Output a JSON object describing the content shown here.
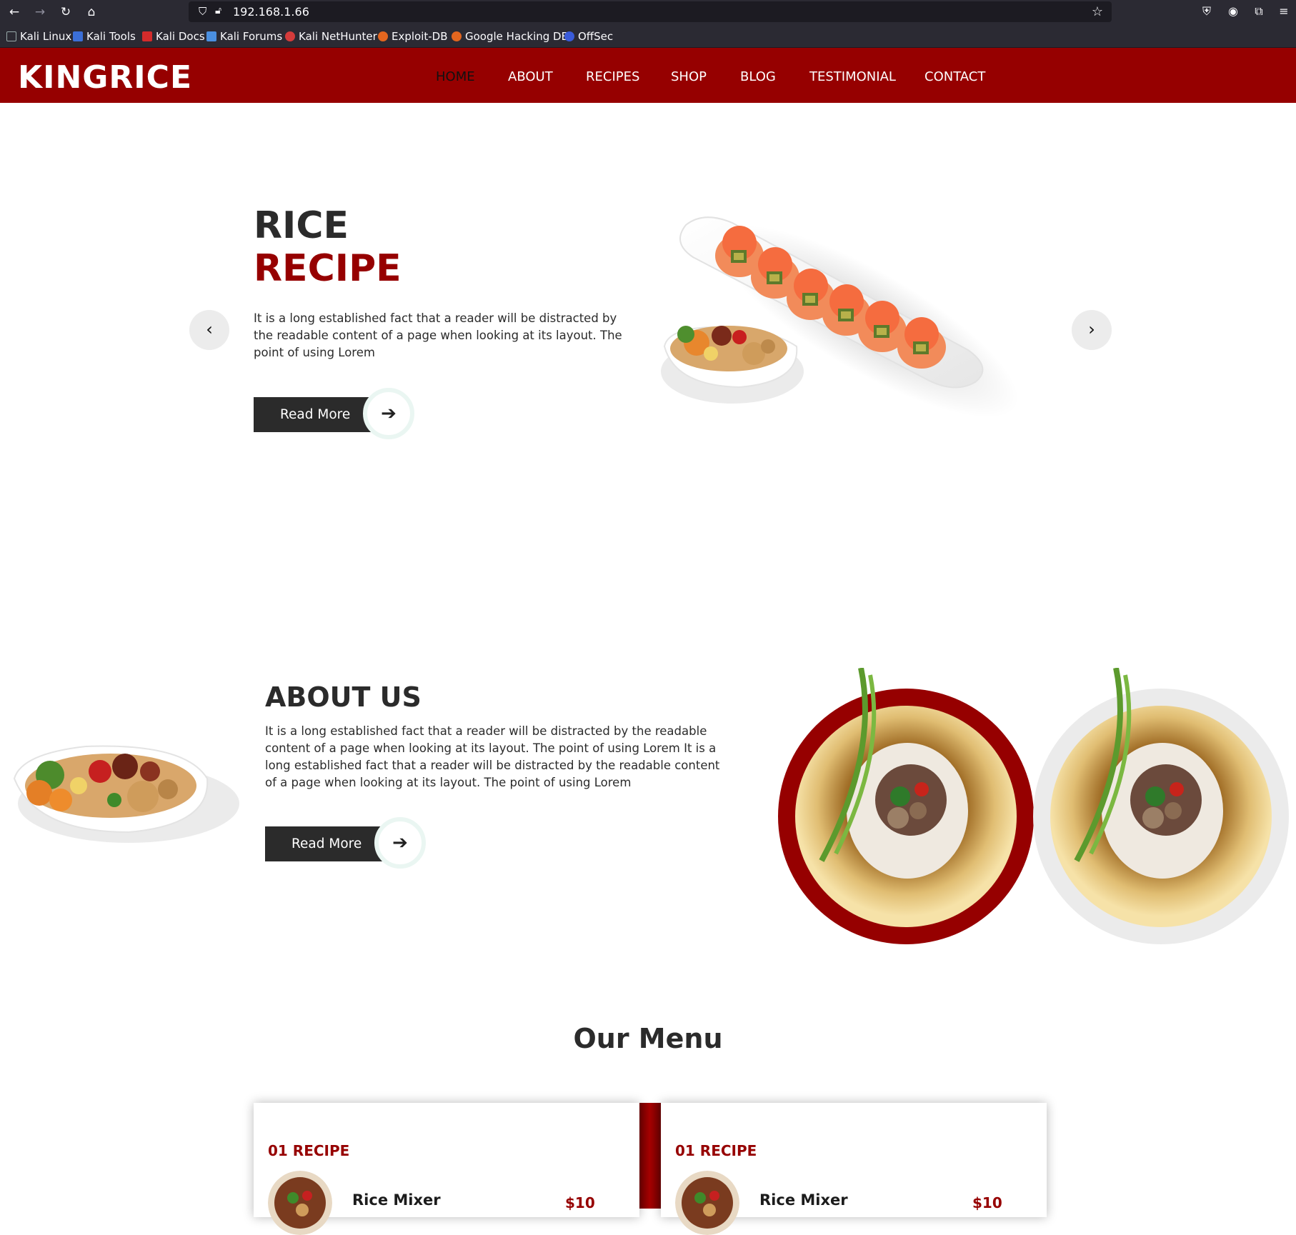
{
  "browser": {
    "url": "192.168.1.66",
    "bookmarks": [
      "Kali Linux",
      "Kali Tools",
      "Kali Docs",
      "Kali Forums",
      "Kali NetHunter",
      "Exploit-DB",
      "Google Hacking DB",
      "OffSec"
    ]
  },
  "site": {
    "logo": "KINGRICE",
    "nav": [
      "HOME",
      "ABOUT",
      "RECIPES",
      "SHOP",
      "BLOG",
      "TESTIMONIAL",
      "CONTACT"
    ],
    "active_nav": "HOME",
    "brand_color": "#960000"
  },
  "hero": {
    "title_line1": "RICE",
    "title_line2": "RECIPE",
    "text": "It is a long established fact that a reader will be distracted by the readable content of a page when looking at its layout. The point of using Lorem",
    "button": "Read More",
    "prev_icon": "chevron-left-icon",
    "next_icon": "chevron-right-icon"
  },
  "about": {
    "title": "ABOUT US",
    "text": "It is a long established fact that a reader will be distracted by the readable content of a page when looking at its layout. The point of using Lorem It is a long established fact that a reader will be distracted by the readable content of a page when looking at its layout. The point of using Lorem",
    "button": "Read More"
  },
  "menu": {
    "title": "Our Menu",
    "cards": [
      {
        "label": "01 RECIPE",
        "name": "Rice Mixer",
        "price": "$10"
      },
      {
        "label": "01 RECIPE",
        "name": "Rice Mixer",
        "price": "$10"
      }
    ]
  }
}
